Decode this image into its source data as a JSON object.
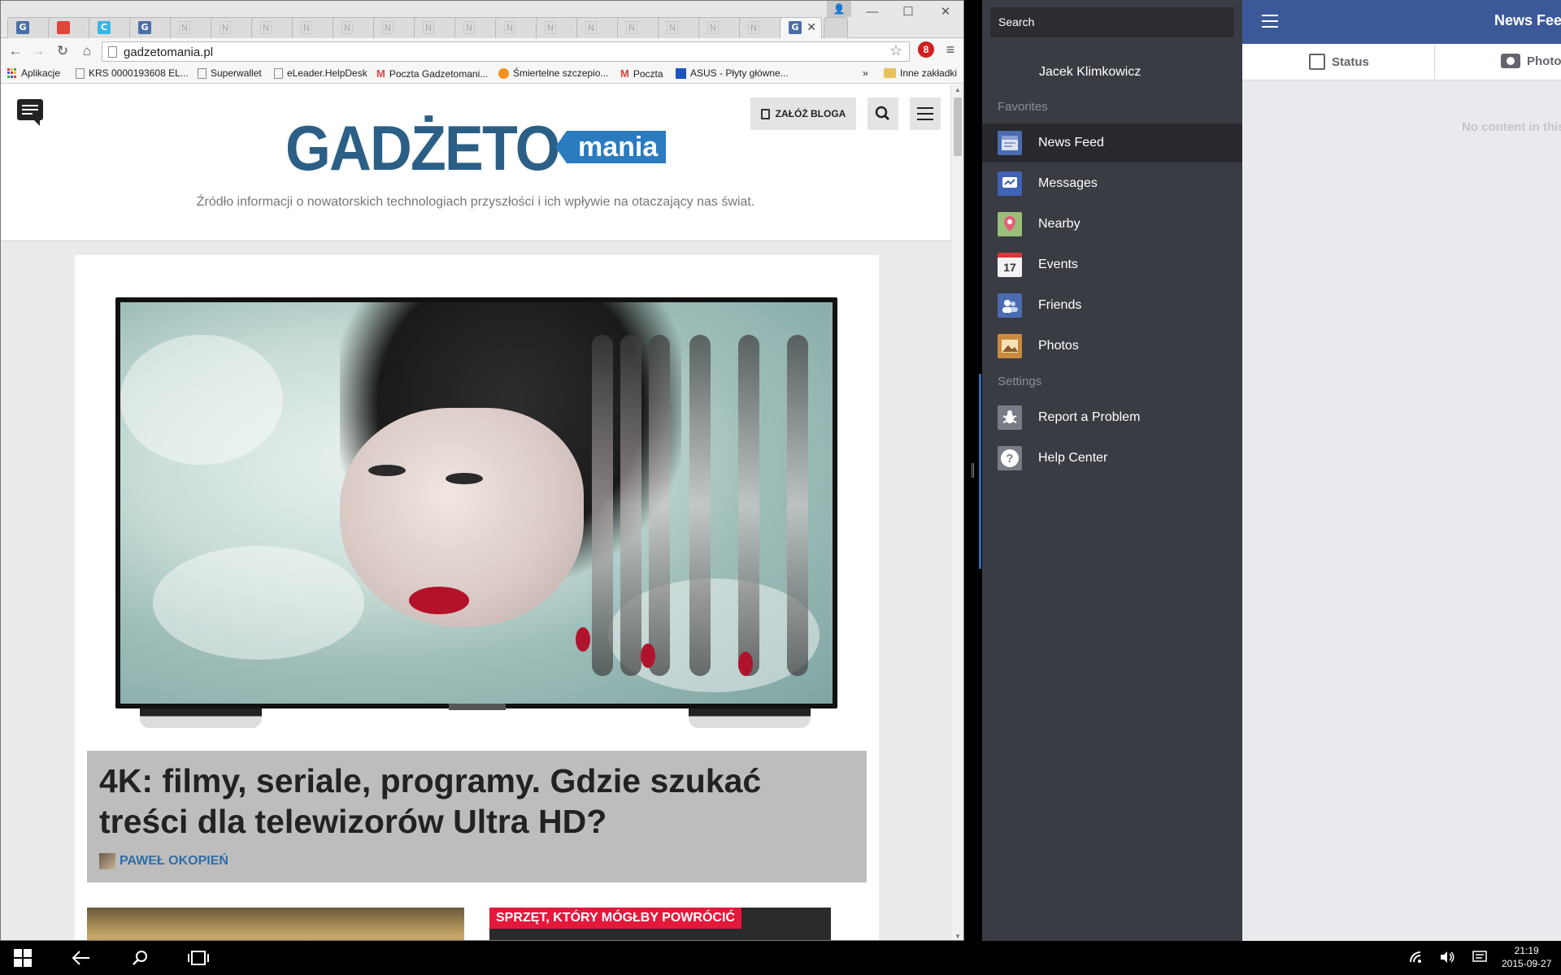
{
  "chrome": {
    "tabs": [
      {
        "favicon": "G",
        "color": "#4a6ea9"
      },
      {
        "favicon": "",
        "color": "#e0453a"
      },
      {
        "favicon": "C",
        "color": "#38b7e8"
      },
      {
        "favicon": "G",
        "color": "#4a6ea9"
      },
      {
        "favicon": "N",
        "color": ""
      },
      {
        "favicon": "N",
        "color": ""
      },
      {
        "favicon": "N",
        "color": ""
      },
      {
        "favicon": "N",
        "color": ""
      },
      {
        "favicon": "N",
        "color": ""
      },
      {
        "favicon": "N",
        "color": ""
      },
      {
        "favicon": "N",
        "color": ""
      },
      {
        "favicon": "N",
        "color": ""
      },
      {
        "favicon": "N",
        "color": ""
      },
      {
        "favicon": "N",
        "color": ""
      },
      {
        "favicon": "N",
        "color": ""
      },
      {
        "favicon": "N",
        "color": ""
      },
      {
        "favicon": "N",
        "color": ""
      },
      {
        "favicon": "N",
        "color": ""
      },
      {
        "favicon": "N",
        "color": ""
      }
    ],
    "active_tab_favicon": "G",
    "close_glyph": "✕",
    "url": "gadzetomania.pl",
    "ext_badge": "8",
    "bookmarks": [
      {
        "label": "Aplikacje",
        "icon": "apps-icon"
      },
      {
        "label": "KRS 0000193608 EL...",
        "icon": "page-icon"
      },
      {
        "label": "Superwallet",
        "icon": "page-icon"
      },
      {
        "label": "eLeader.HelpDesk",
        "icon": "page-icon"
      },
      {
        "label": "Poczta Gadzetomani...",
        "icon": "gmail-icon"
      },
      {
        "label": "Śmiertelne szczepio...",
        "icon": "orange-dot-icon"
      },
      {
        "label": "Poczta",
        "icon": "gmail-icon"
      },
      {
        "label": "ASUS - Płyty główne...",
        "icon": "asus-icon"
      }
    ],
    "overflow_glyph": "»",
    "other_bookmarks": "Inne zakładki"
  },
  "site": {
    "logo_main": "GADŻETO",
    "logo_tag": "mania",
    "create_blog": "ZAŁÓŻ BLOGA",
    "tagline": "Źródło informacji o nowatorskich technologiach przyszłości i ich wpływie na otaczający nas świat.",
    "article_title": "4K: filmy, seriale, programy. Gdzie szukać treści dla telewizorów Ultra HD?",
    "article_author": "PAWEŁ OKOPIEŃ",
    "next_label": "SPRZĘT, KTÓRY MÓGŁBY POWRÓCIĆ",
    "brand_color": "#2b5f86",
    "accent_color": "#e4183b"
  },
  "facebook": {
    "search_placeholder": "Search",
    "user_name": "Jacek Klimkowicz",
    "favorites_heading": "Favorites",
    "favorites": [
      {
        "label": "News Feed",
        "icon": "news-feed-icon",
        "active": true
      },
      {
        "label": "Messages",
        "icon": "messages-icon",
        "active": false
      },
      {
        "label": "Nearby",
        "icon": "nearby-icon",
        "active": false
      },
      {
        "label": "Events",
        "icon": "events-icon",
        "active": false,
        "badge": "17"
      },
      {
        "label": "Friends",
        "icon": "friends-icon",
        "active": false
      },
      {
        "label": "Photos",
        "icon": "photos-icon",
        "active": false
      }
    ],
    "settings_heading": "Settings",
    "settings": [
      {
        "label": "Report a Problem",
        "icon": "bug-icon"
      },
      {
        "label": "Help Center",
        "icon": "help-icon",
        "glyph": "?"
      }
    ],
    "title": "News Feed",
    "action_status": "Status",
    "action_photo": "Photo",
    "empty_text": "No content in this",
    "topbar_color": "#3b5998"
  },
  "taskbar": {
    "time": "21:19",
    "date": "2015-09-27"
  }
}
